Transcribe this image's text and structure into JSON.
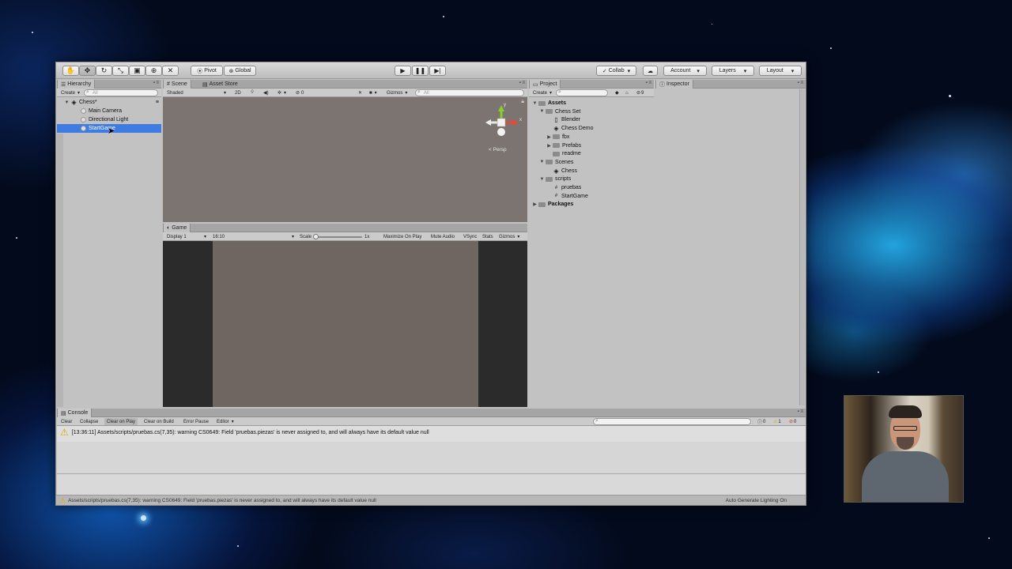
{
  "toolbar": {
    "tools": [
      "hand-tool-icon",
      "move-tool-icon",
      "rotate-tool-icon",
      "scale-tool-icon",
      "rect-tool-icon",
      "transform-tool-icon",
      "custom-tool-icon"
    ],
    "pivot_label": "Pivot",
    "global_label": "Global",
    "collab_label": "Collab",
    "account_label": "Account",
    "layers_label": "Layers",
    "layout_label": "Layout"
  },
  "hierarchy": {
    "tab_label": "Hierarchy",
    "create_label": "Create",
    "search_placeholder": "All",
    "scene_name": "Chess*",
    "items": [
      {
        "label": "Main Camera"
      },
      {
        "label": "Directional Light"
      },
      {
        "label": "StartGame",
        "selected": true
      }
    ]
  },
  "scene": {
    "tabs": [
      "Scene",
      "Asset Store"
    ],
    "shading_label": "Shaded",
    "mode_2d": "2D",
    "effects_count": "0",
    "gizmos_label": "Gizmos",
    "search_placeholder": "All",
    "persp_label": "Persp",
    "axis_y": "y",
    "axis_x": "x"
  },
  "game": {
    "tab_label": "Game",
    "display_label": "Display 1",
    "aspect_label": "16:10",
    "scale_label": "Scale",
    "scale_value": "1x",
    "maximize_label": "Maximize On Play",
    "mute_label": "Mute Audio",
    "vsync_label": "VSync",
    "stats_label": "Stats",
    "gizmos_label": "Gizmos"
  },
  "project": {
    "tab_label": "Project",
    "create_label": "Create",
    "filter_count": "9",
    "tree": [
      {
        "label": "Assets",
        "depth": 0,
        "type": "folder",
        "fold": "open",
        "bold": true
      },
      {
        "label": "Chess Set",
        "depth": 1,
        "type": "folder",
        "fold": "open"
      },
      {
        "label": "Blender",
        "depth": 2,
        "type": "file"
      },
      {
        "label": "Chess Demo",
        "depth": 2,
        "type": "unity"
      },
      {
        "label": "fbx",
        "depth": 2,
        "type": "folder",
        "fold": "closed"
      },
      {
        "label": "Prefabs",
        "depth": 2,
        "type": "folder",
        "fold": "closed"
      },
      {
        "label": "readme",
        "depth": 2,
        "type": "folder"
      },
      {
        "label": "Scenes",
        "depth": 1,
        "type": "folder",
        "fold": "open"
      },
      {
        "label": "Chess",
        "depth": 2,
        "type": "unity"
      },
      {
        "label": "scripts",
        "depth": 1,
        "type": "folder",
        "fold": "open"
      },
      {
        "label": "pruebas",
        "depth": 2,
        "type": "script"
      },
      {
        "label": "StartGame",
        "depth": 2,
        "type": "script"
      },
      {
        "label": "Packages",
        "depth": 0,
        "type": "folder",
        "fold": "closed",
        "bold": true
      }
    ]
  },
  "inspector": {
    "tab_label": "Inspector"
  },
  "console": {
    "tab_label": "Console",
    "buttons": [
      "Clear",
      "Collapse",
      "Clear on Play",
      "Clear on Build",
      "Error Pause",
      "Editor"
    ],
    "info_count": "0",
    "warning_count": "1",
    "error_count": "0",
    "message": "[13:36:11] Assets/scripts/pruebas.cs(7,35): warning CS0649: Field 'pruebas.piezas' is never assigned to, and will always have its default value null"
  },
  "status_bar": {
    "message": "Assets/scripts/pruebas.cs(7,35): warning CS0649: Field 'pruebas.piezas' is never assigned to, and will always have its default value null",
    "right_label": "Auto Generate Lighting On"
  },
  "colors": {
    "selection": "#3e7ce2",
    "scene_bg": "#7c7470",
    "game_bg": "#6f6662",
    "letterbox": "#2b2b2b",
    "warning": "#e0a400"
  }
}
